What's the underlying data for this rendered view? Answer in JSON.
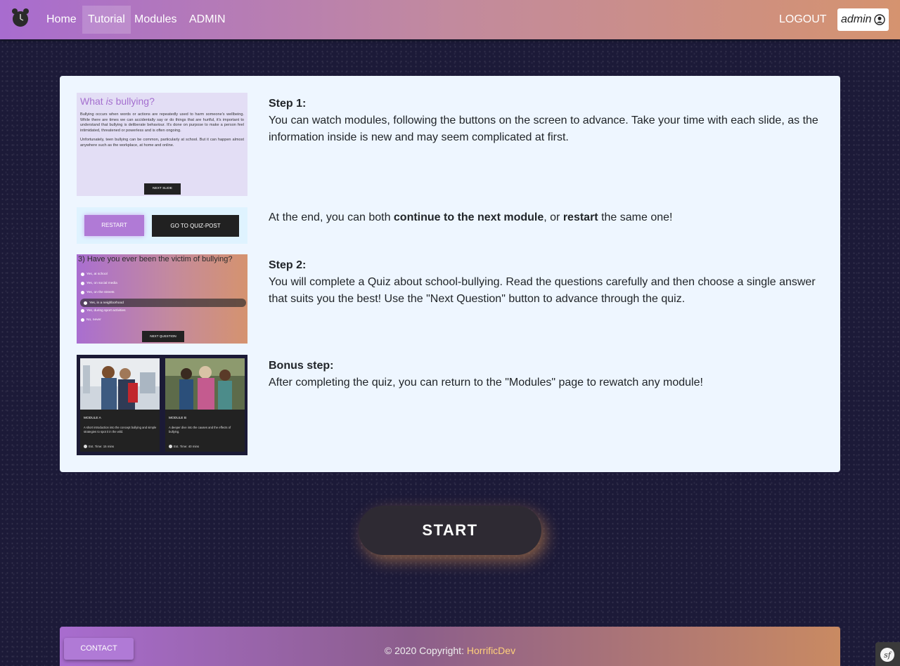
{
  "nav": {
    "logo_icon": "alarm-clock-icon",
    "links": [
      "Home",
      "Tutorial",
      "Modules",
      "ADMIN"
    ],
    "active": "Tutorial",
    "logout": "LOGOUT",
    "user": "admin",
    "user_icon": "user-circle-icon"
  },
  "steps": [
    {
      "title": "Step 1:",
      "text": "You can watch modules, following the buttons on the screen to advance. Take your time with each slide, as the information inside is new and may seem complicated at first."
    },
    {
      "text_a": "At the end, you can both ",
      "bold_a": "continue to the next module",
      "text_b": ", or ",
      "bold_b": "restart",
      "text_c": " the same one!"
    },
    {
      "title": "Step 2:",
      "text": "You will complete a Quiz about school-bullying. Read the questions carefully and then choose a single answer that suits you the best! Use the \"Next Question\" button to advance through the quiz."
    },
    {
      "title": "Bonus step:",
      "text": "After completing the quiz, you can return to the \"Modules\" page to rewatch any module!"
    }
  ],
  "thumb1": {
    "title_a": "What ",
    "title_i": "is",
    "title_b": " bullying?",
    "p1": "Bullying occurs when words or actions are repeatedly used to harm someone's wellbeing. While there are times we can accidentally say or do things that are hurtful, it's important to understand that bullying is deliberate behaviour. It's done on purpose to make a person feel intimidated, threatened or powerless and is often ongoing.",
    "p2": "Unfortunately, teen bullying can be common, particularly at school. But it can happen almost anywhere such as the workplace, at home and online.",
    "button": "NEXT SLIDE"
  },
  "thumb2": {
    "restart": "RESTART",
    "quiz": "GO TO QUIZ-POST"
  },
  "thumb3": {
    "question": "3) Have you ever been the victim of bullying?",
    "options": [
      "Yes, at school",
      "Yes, on social media",
      "Yes, on the streets",
      "Yes, in a neighborhood",
      "Yes, during sport activities",
      "No, never"
    ],
    "selected_index": 3,
    "button": "NEXT QUESTION"
  },
  "thumb4": {
    "modules": [
      {
        "name": "MODULE A",
        "desc": "A short introduction into the concept bullying and simple strategies to spot it in the wild.",
        "time": "Est. Time: 15 mins"
      },
      {
        "name": "MODULE B",
        "desc": "A deeper dive into the causes and the effects of bullying.",
        "time": "Est. Time: 40 mins"
      }
    ]
  },
  "start": "START",
  "footer": {
    "contact": "CONTACT",
    "copyright": "© 2020 Copyright: ",
    "brand": "HorrificDev"
  },
  "colors": {
    "accent": "#b07ad6",
    "bg": "#1c1a38",
    "card": "#eef6ff",
    "brand": "#ffd07a"
  }
}
